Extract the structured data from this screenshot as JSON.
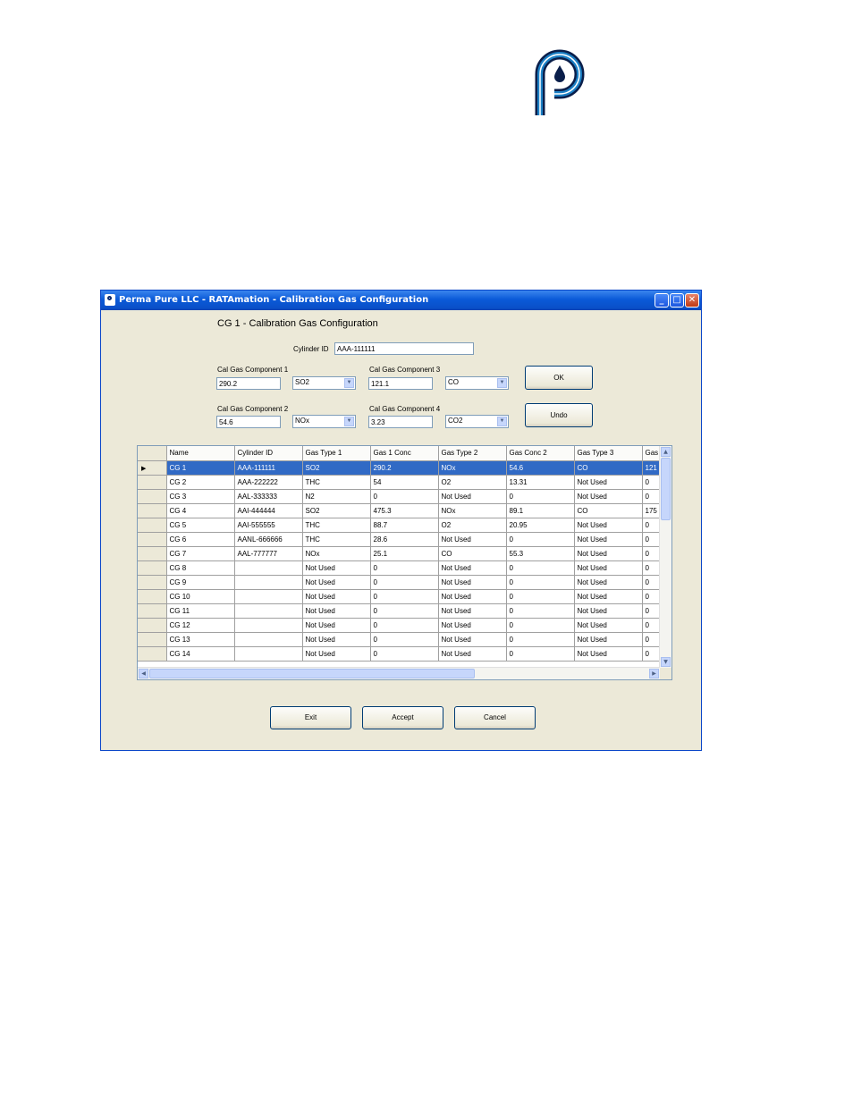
{
  "window": {
    "title": "Perma Pure LLC - RATAmation - Calibration Gas Configuration",
    "heading": "CG 1 - Calibration Gas Configuration"
  },
  "form": {
    "cylinder_label": "Cylinder ID",
    "cylinder_value": "AAA-111111",
    "comp1_label": "Cal Gas Component 1",
    "comp1_value": "290.2",
    "comp1_type": "SO2",
    "comp2_label": "Cal Gas Component 2",
    "comp2_value": "54.6",
    "comp2_type": "NOx",
    "comp3_label": "Cal Gas Component 3",
    "comp3_value": "121.1",
    "comp3_type": "CO",
    "comp4_label": "Cal Gas Component 4",
    "comp4_value": "3.23",
    "comp4_type": "CO2",
    "ok_label": "OK",
    "undo_label": "Undo"
  },
  "grid": {
    "columns": [
      "Name",
      "Cylinder ID",
      "Gas Type 1",
      "Gas 1 Conc",
      "Gas Type 2",
      "Gas Conc 2",
      "Gas Type 3",
      "Gas"
    ],
    "rows": [
      [
        "CG 1",
        "AAA-111111",
        "SO2",
        "290.2",
        "NOx",
        "54.6",
        "CO",
        "121"
      ],
      [
        "CG 2",
        "AAA-222222",
        "THC",
        "54",
        "O2",
        "13.31",
        "Not Used",
        "0"
      ],
      [
        "CG 3",
        "AAL-333333",
        "N2",
        "0",
        "Not Used",
        "0",
        "Not Used",
        "0"
      ],
      [
        "CG 4",
        "AAI-444444",
        "SO2",
        "475.3",
        "NOx",
        "89.1",
        "CO",
        "175"
      ],
      [
        "CG 5",
        "AAI-555555",
        "THC",
        "88.7",
        "O2",
        "20.95",
        "Not Used",
        "0"
      ],
      [
        "CG 6",
        "AANL-666666",
        "THC",
        "28.6",
        "Not Used",
        "0",
        "Not Used",
        "0"
      ],
      [
        "CG 7",
        "AAL-777777",
        "NOx",
        "25.1",
        "CO",
        "55.3",
        "Not Used",
        "0"
      ],
      [
        "CG 8",
        "",
        "Not Used",
        "0",
        "Not Used",
        "0",
        "Not Used",
        "0"
      ],
      [
        "CG 9",
        "",
        "Not Used",
        "0",
        "Not Used",
        "0",
        "Not Used",
        "0"
      ],
      [
        "CG 10",
        "",
        "Not Used",
        "0",
        "Not Used",
        "0",
        "Not Used",
        "0"
      ],
      [
        "CG 11",
        "",
        "Not Used",
        "0",
        "Not Used",
        "0",
        "Not Used",
        "0"
      ],
      [
        "CG 12",
        "",
        "Not Used",
        "0",
        "Not Used",
        "0",
        "Not Used",
        "0"
      ],
      [
        "CG 13",
        "",
        "Not Used",
        "0",
        "Not Used",
        "0",
        "Not Used",
        "0"
      ],
      [
        "CG 14",
        "",
        "Not Used",
        "0",
        "Not Used",
        "0",
        "Not Used",
        "0"
      ]
    ],
    "selected_row": 0
  },
  "buttons": {
    "exit": "Exit",
    "accept": "Accept",
    "cancel": "Cancel"
  },
  "colors": {
    "titlebar": "#0a5ad8",
    "selection": "#316ac5",
    "logo_blue": "#1b7fc4",
    "logo_dark": "#0a1e4a"
  }
}
